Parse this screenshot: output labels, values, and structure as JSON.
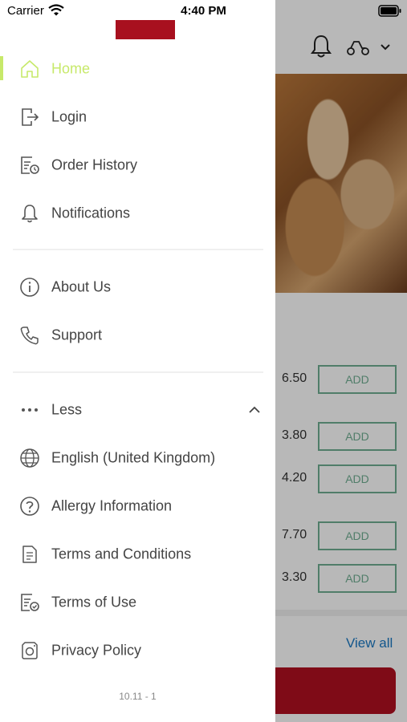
{
  "status_bar": {
    "carrier": "Carrier",
    "time": "4:40 PM"
  },
  "drawer": {
    "menu_primary": [
      {
        "label": "Home",
        "icon": "home-icon",
        "active": true
      },
      {
        "label": "Login",
        "icon": "login-icon"
      },
      {
        "label": "Order History",
        "icon": "order-history-icon"
      },
      {
        "label": "Notifications",
        "icon": "bell-icon"
      }
    ],
    "menu_secondary": [
      {
        "label": "About Us",
        "icon": "info-icon"
      },
      {
        "label": "Support",
        "icon": "phone-icon"
      }
    ],
    "less_label": "Less",
    "menu_more": [
      {
        "label": "English (United Kingdom)",
        "icon": "globe-icon"
      },
      {
        "label": "Allergy Information",
        "icon": "question-icon"
      },
      {
        "label": "Terms and Conditions",
        "icon": "document-icon"
      },
      {
        "label": "Terms of Use",
        "icon": "document-check-icon"
      },
      {
        "label": "Privacy Policy",
        "icon": "privacy-icon"
      }
    ],
    "version": "10.11 - 1",
    "accent_color": "#c7e96a",
    "logo_color": "#a8101f"
  },
  "background": {
    "prices": [
      "6.50",
      "3.80",
      "4.20",
      "7.70",
      "3.30"
    ],
    "add_label": "ADD",
    "view_all": "View all"
  }
}
